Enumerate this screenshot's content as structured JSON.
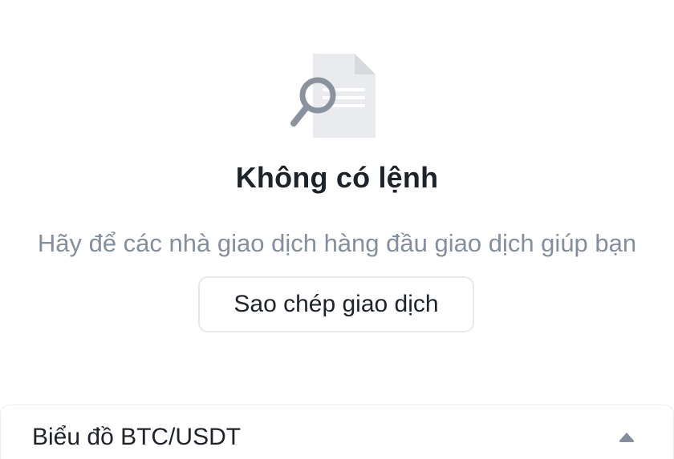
{
  "empty_state": {
    "illustration_icon": "document-search-icon",
    "title": "Không có lệnh",
    "subtitle": "Hãy để các nhà giao dịch hàng đầu giao dịch giúp bạn",
    "copy_button_label": "Sao chép giao dịch"
  },
  "chart_panel": {
    "label": "Biểu đồ BTC/USDT",
    "toggle_icon": "caret-up-icon"
  },
  "colors": {
    "title_text": "#1e2329",
    "muted_text": "#848e9c",
    "icon_gray": "#8a929e",
    "icon_paper": "#e9ebee",
    "border": "#e6e8ea"
  }
}
